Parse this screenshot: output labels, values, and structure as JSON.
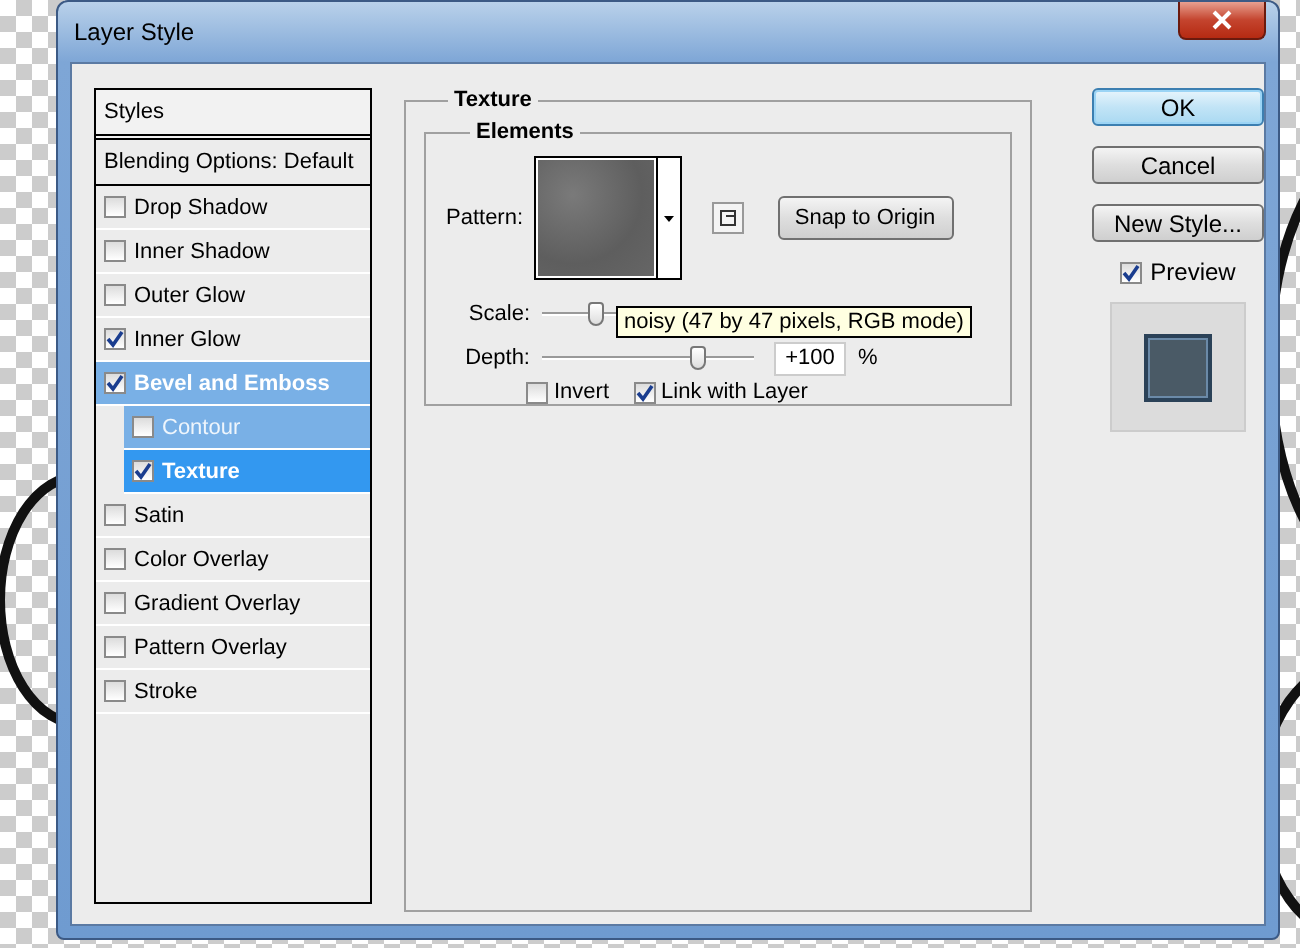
{
  "window": {
    "title": "Layer Style"
  },
  "styles_panel": {
    "header": "Styles",
    "blending_options": "Blending Options: Default",
    "items": [
      {
        "label": "Drop Shadow",
        "checked": false,
        "selected": false
      },
      {
        "label": "Inner Shadow",
        "checked": false,
        "selected": false
      },
      {
        "label": "Outer Glow",
        "checked": false,
        "selected": false
      },
      {
        "label": "Inner Glow",
        "checked": true,
        "selected": false
      },
      {
        "label": "Bevel and Emboss",
        "checked": true,
        "selected": false,
        "children": [
          {
            "label": "Contour",
            "checked": false,
            "selected": false
          },
          {
            "label": "Texture",
            "checked": true,
            "selected": true
          }
        ]
      },
      {
        "label": "Satin",
        "checked": false,
        "selected": false
      },
      {
        "label": "Color Overlay",
        "checked": false,
        "selected": false
      },
      {
        "label": "Gradient Overlay",
        "checked": false,
        "selected": false
      },
      {
        "label": "Pattern Overlay",
        "checked": false,
        "selected": false
      },
      {
        "label": "Stroke",
        "checked": false,
        "selected": false
      }
    ]
  },
  "texture": {
    "title": "Texture",
    "elements": {
      "title": "Elements",
      "pattern_label": "Pattern:",
      "snap_button": "Snap to Origin",
      "scale": {
        "label": "Scale:",
        "level": 0.23
      },
      "depth": {
        "label": "Depth:",
        "level": 0.75,
        "value": "+100",
        "unit": "%"
      },
      "invert": {
        "label": "Invert",
        "checked": false
      },
      "link_with_layer": {
        "label": "Link with Layer",
        "checked": true
      },
      "tooltip": "noisy (47 by 47 pixels, RGB mode)"
    }
  },
  "buttons": [
    {
      "label": "OK",
      "default": true
    },
    {
      "label": "Cancel",
      "default": false
    },
    {
      "label": "New Style...",
      "default": false
    }
  ],
  "preview": {
    "label": "Preview",
    "checked": true
  }
}
